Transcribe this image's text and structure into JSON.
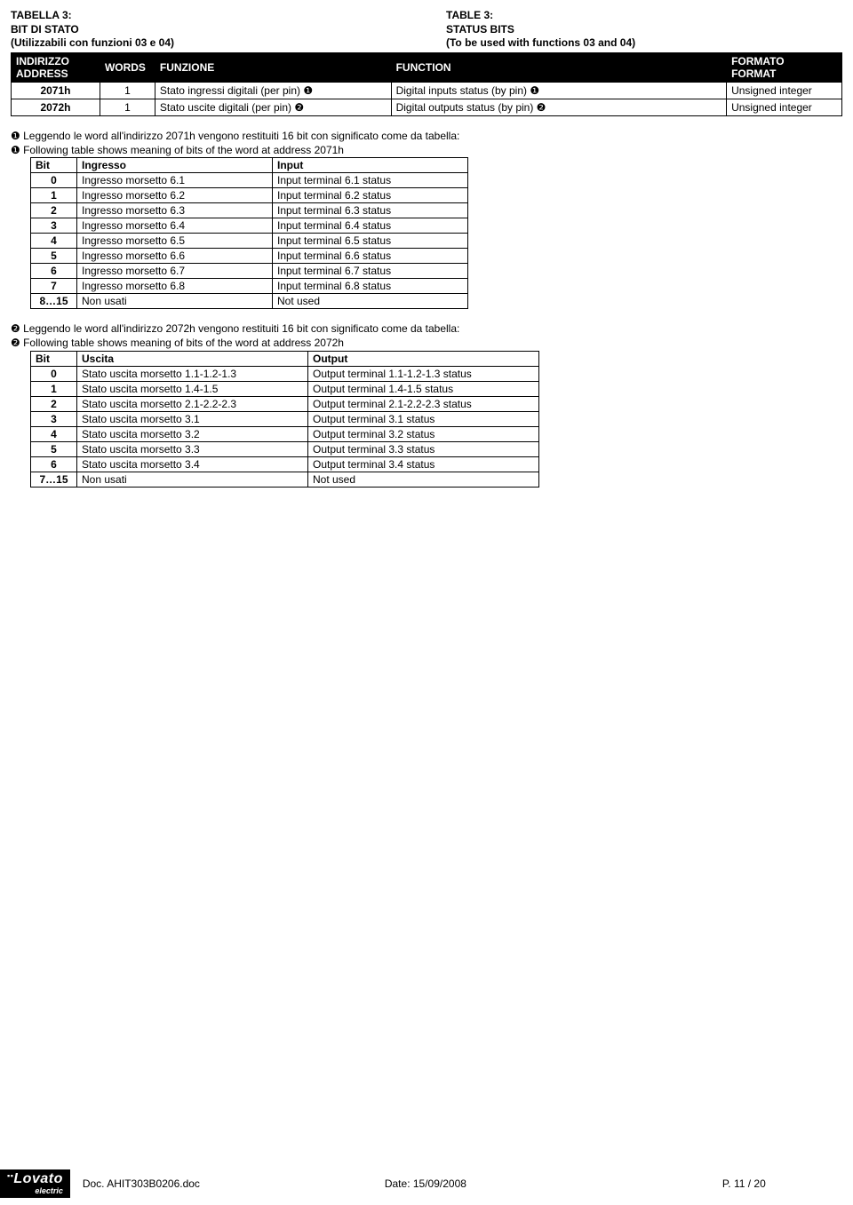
{
  "titles": {
    "it_title": "TABELLA 3:",
    "it_sub": "BIT DI STATO",
    "it_func": "(Utilizzabili con funzioni 03 e 04)",
    "en_title": "TABLE 3:",
    "en_sub": "STATUS BITS",
    "en_func": "(To be used with functions 03 and 04)"
  },
  "main_headers": {
    "h1a": "INDIRIZZO",
    "h1b": "ADDRESS",
    "h2": "WORDS",
    "h3": "FUNZIONE",
    "h4": "FUNCTION",
    "h5a": "FORMATO",
    "h5b": "FORMAT"
  },
  "main_rows": [
    {
      "addr": "2071h",
      "words": "1",
      "funz": "Stato ingressi digitali (per pin) ❶",
      "func": "Digital inputs status (by pin) ❶",
      "fmt": "Unsigned integer"
    },
    {
      "addr": "2072h",
      "words": "1",
      "funz": "Stato uscite digitali (per pin) ❷",
      "func": "Digital outputs status (by pin) ❷",
      "fmt": "Unsigned integer"
    }
  ],
  "note1_it": "❶ Leggendo le word all'indirizzo 2071h vengono restituiti 16 bit con significato come da tabella:",
  "note1_en": "❶ Following table shows meaning of bits of the word  at address 2071h",
  "bits1_headers": {
    "bit": "Bit",
    "ing": "Ingresso",
    "inp": "Input"
  },
  "bits1": [
    {
      "b": "0",
      "it": "Ingresso morsetto 6.1",
      "en": "Input terminal 6.1 status"
    },
    {
      "b": "1",
      "it": "Ingresso morsetto 6.2",
      "en": "Input terminal 6.2 status"
    },
    {
      "b": "2",
      "it": "Ingresso morsetto 6.3",
      "en": "Input terminal 6.3 status"
    },
    {
      "b": "3",
      "it": "Ingresso morsetto 6.4",
      "en": "Input terminal 6.4 status"
    },
    {
      "b": "4",
      "it": "Ingresso morsetto 6.5",
      "en": "Input terminal 6.5 status"
    },
    {
      "b": "5",
      "it": "Ingresso morsetto 6.6",
      "en": "Input terminal 6.6 status"
    },
    {
      "b": "6",
      "it": "Ingresso morsetto 6.7",
      "en": "Input terminal 6.7 status"
    },
    {
      "b": "7",
      "it": "Ingresso morsetto 6.8",
      "en": "Input terminal 6.8 status"
    },
    {
      "b": "8…15",
      "it": "Non usati",
      "en": "Not used"
    }
  ],
  "note2_it": "❷ Leggendo le word all'indirizzo 2072h vengono restituiti 16 bit con significato come da tabella:",
  "note2_en": "❷ Following table shows meaning of bits of the word  at address 2072h",
  "bits2_headers": {
    "bit": "Bit",
    "usc": "Uscita",
    "out": "Output"
  },
  "bits2": [
    {
      "b": "0",
      "it": "Stato uscita morsetto 1.1-1.2-1.3",
      "en": "Output terminal 1.1-1.2-1.3 status"
    },
    {
      "b": "1",
      "it": "Stato uscita morsetto 1.4-1.5",
      "en": "Output terminal 1.4-1.5 status"
    },
    {
      "b": "2",
      "it": "Stato uscita morsetto 2.1-2.2-2.3",
      "en": "Output terminal 2.1-2.2-2.3 status"
    },
    {
      "b": "3",
      "it": "Stato uscita morsetto 3.1",
      "en": "Output terminal 3.1 status"
    },
    {
      "b": "4",
      "it": "Stato uscita morsetto 3.2",
      "en": "Output terminal 3.2 status"
    },
    {
      "b": "5",
      "it": "Stato uscita morsetto 3.3",
      "en": "Output terminal 3.3 status"
    },
    {
      "b": "6",
      "it": "Stato uscita morsetto 3.4",
      "en": "Output terminal 3.4 status"
    },
    {
      "b": "7…15",
      "it": "Non usati",
      "en": "Not used"
    }
  ],
  "footer": {
    "logo_big": "Lovato",
    "logo_small": "electric",
    "doc": "Doc. AHIT303B0206.doc",
    "date": "Date: 15/09/2008",
    "page": "P.  11 / 20"
  }
}
